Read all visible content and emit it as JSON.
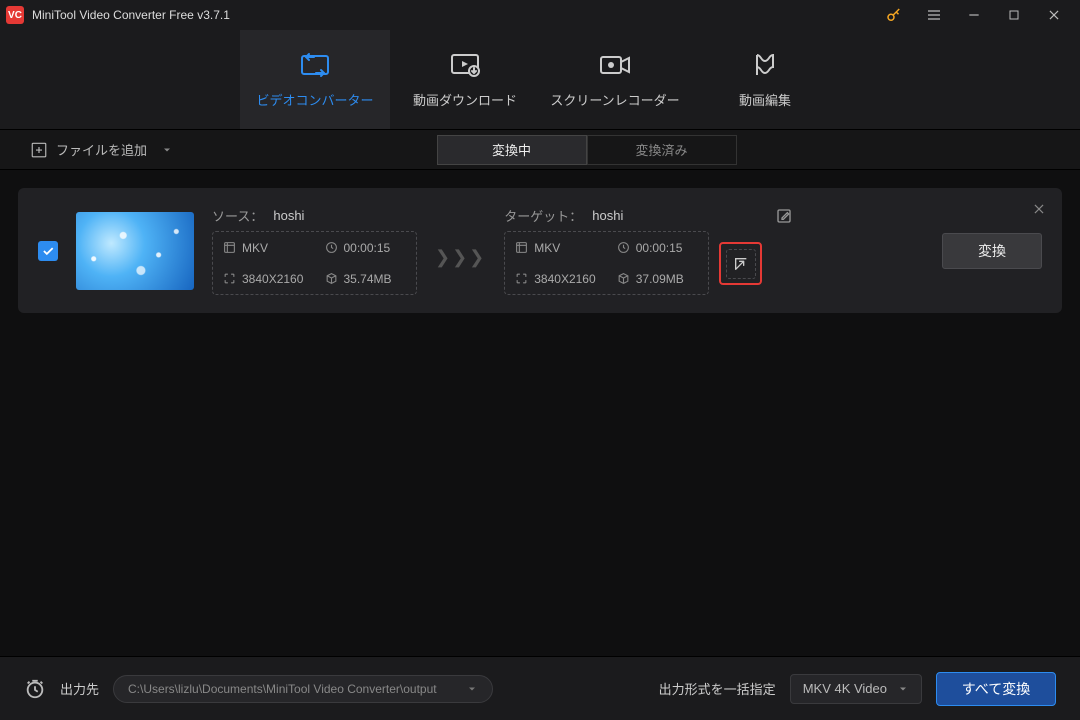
{
  "title": "MiniTool Video Converter Free v3.7.1",
  "main_tabs": {
    "converter": "ビデオコンバーター",
    "download": "動画ダウンロード",
    "recorder": "スクリーンレコーダー",
    "editor": "動画編集"
  },
  "toolbar": {
    "add_file": "ファイルを追加"
  },
  "sub_tabs": {
    "converting": "変換中",
    "converted": "変換済み"
  },
  "item": {
    "source_label": "ソース：",
    "source_name": "hoshi",
    "source": {
      "format": "MKV",
      "duration": "00:00:15",
      "resolution": "3840X2160",
      "size": "35.74MB"
    },
    "target_label": "ターゲット：",
    "target_name": "hoshi",
    "target": {
      "format": "MKV",
      "duration": "00:00:15",
      "resolution": "3840X2160",
      "size": "37.09MB"
    },
    "convert_btn": "変換"
  },
  "footer": {
    "output_label": "出力先",
    "output_path": "C:\\Users\\lizlu\\Documents\\MiniTool Video Converter\\output",
    "format_label": "出力形式を一括指定",
    "format_value": "MKV 4K Video",
    "convert_all": "すべて変換"
  }
}
